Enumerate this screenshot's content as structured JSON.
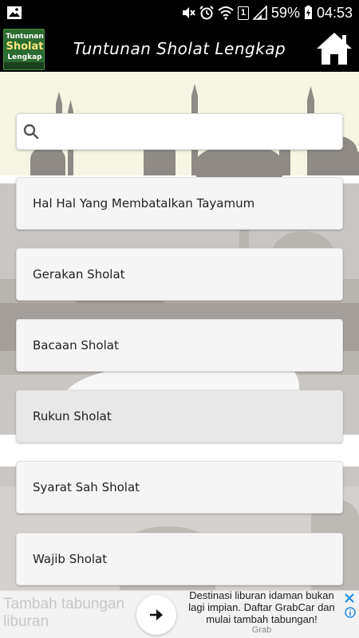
{
  "status_bar": {
    "battery_percent": "59%",
    "time": "04:53",
    "sim_label": "1",
    "icons": [
      "image-notification-icon",
      "mute-icon",
      "alarm-icon",
      "wifi-icon",
      "sim-icon",
      "signal-icon",
      "battery-charging-icon"
    ]
  },
  "app_bar": {
    "title": "Tuntunan Sholat Lengkap",
    "logo_lines": [
      "Tuntunan",
      "Sholat",
      "Lengkap"
    ],
    "home_icon": "home-icon"
  },
  "search": {
    "placeholder": "",
    "value": "",
    "icon": "search-icon"
  },
  "list": {
    "items": [
      {
        "label": "Hal Hal Yang Membatalkan Tayamum"
      },
      {
        "label": "Gerakan Sholat"
      },
      {
        "label": "Bacaan Sholat"
      },
      {
        "label": "Rukun Sholat"
      },
      {
        "label": "Syarat Sah Sholat"
      },
      {
        "label": "Wajib Sholat"
      }
    ]
  },
  "ad": {
    "headline": "Tambah tabungan liburan",
    "body": "Destinasi liburan idaman bukan lagi impian. Daftar GrabCar dan mulai tambah tabungan!",
    "brand": "Grab",
    "arrow_icon": "arrow-right-icon",
    "close_icon": "close-icon",
    "info_icon": "info-icon"
  },
  "colors": {
    "app_bar": "#000000",
    "sky": "#f6f5e4",
    "silhouette_dark": "#8f8a86",
    "silhouette_light": "#c9c6c3",
    "list_item_bg": "#f5f5f5",
    "text": "#212121",
    "ad_link": "#1565c0"
  }
}
